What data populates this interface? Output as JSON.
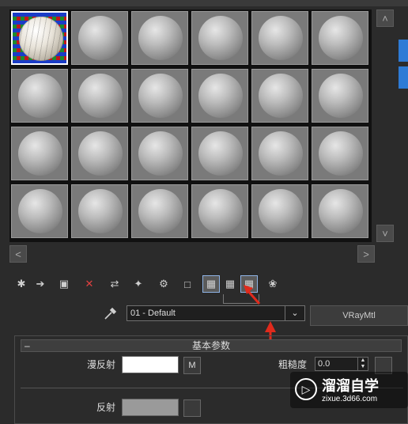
{
  "material_editor": {
    "slots": {
      "rows": 4,
      "cols": 6,
      "selected_index": 0
    },
    "nav": {
      "scroll_up": "˄",
      "scroll_down": "˅",
      "scroll_left": "˂",
      "scroll_right": "˃"
    },
    "toolbar": {
      "icons": [
        "get-material-icon",
        "put-to-scene-icon",
        "assign-to-selection-icon",
        "delete-icon",
        "copy-material-icon",
        "make-unique-icon",
        "put-to-library-icon",
        "material-id-icon",
        "show-map-icon",
        "show-shaded-icon",
        "show-end-result-icon",
        "go-to-parent-icon"
      ],
      "glyphs": [
        "✱",
        "➔",
        "▣",
        "✕",
        "⇄",
        "✦",
        "⚙",
        "□",
        "▦",
        "▦",
        "▦",
        "❀"
      ]
    },
    "material_name": "01 - Default",
    "material_type": "VRayMtl",
    "dropdown_glyph": "⌄",
    "rollout": {
      "toggle": "–",
      "title": "基本参数"
    },
    "params": {
      "diffuse_label": "漫反射",
      "diffuse_map_button": "M",
      "diffuse_color": "#ffffff",
      "roughness_label": "粗糙度",
      "roughness_value": "0.0",
      "reflect_label": "反射",
      "reflect_color": "#9a9a9a"
    },
    "watermark": {
      "logo": "▷",
      "title": "溜溜自学",
      "url": "zixue.3d66.com"
    },
    "colors": {
      "accent_blue": "#2e7bd6",
      "annotation_red": "#e02a1c"
    }
  }
}
